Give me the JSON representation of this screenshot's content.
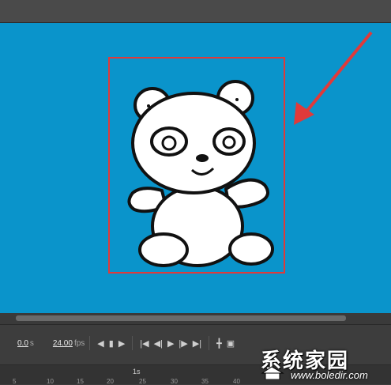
{
  "colors": {
    "stage": "#0a94cb",
    "selection": "#e03a3a",
    "arrow": "#e03a3a",
    "panel": "#3d3d3d"
  },
  "timeline": {
    "time_value": "0.0",
    "time_unit": "s",
    "fps_value": "24.00",
    "fps_unit": "fps",
    "second_marker": "1s",
    "ruler_numbers": [
      "5",
      "10",
      "15",
      "20",
      "25",
      "30",
      "35",
      "40"
    ]
  },
  "watermark": {
    "title": "系统家园",
    "url": "www.boledir.com"
  },
  "icons": [
    "panda-drawing",
    "red-arrow-icon",
    "prev-frame-icon",
    "stop-icon",
    "next-frame-icon",
    "first-frame-icon",
    "step-back-icon",
    "play-icon",
    "step-forward-icon",
    "last-frame-icon"
  ]
}
